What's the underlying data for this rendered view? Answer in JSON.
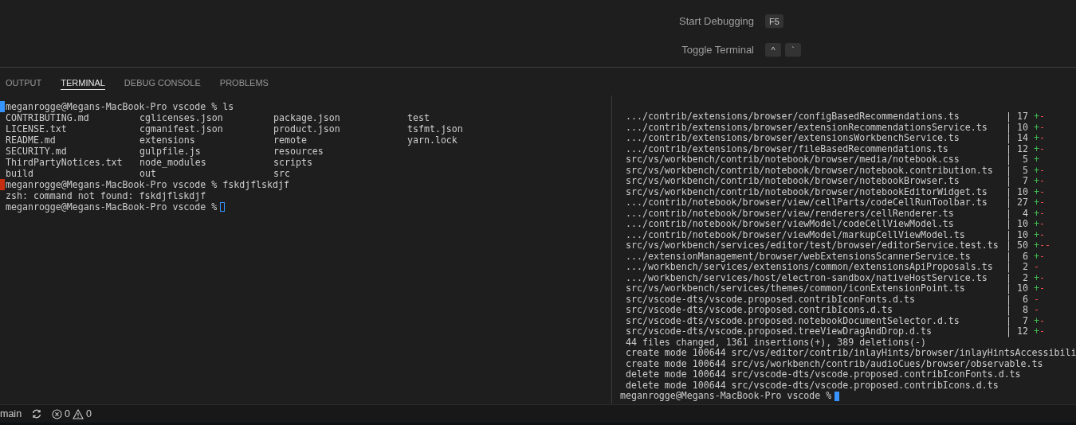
{
  "editor_hints": [
    {
      "label": "Start Debugging",
      "keys": [
        "F5"
      ]
    },
    {
      "label": "Toggle Terminal",
      "keys": [
        "^",
        "`"
      ]
    }
  ],
  "panel": {
    "tabs": [
      {
        "label": "OUTPUT",
        "selected": false
      },
      {
        "label": "TERMINAL",
        "selected": true
      },
      {
        "label": "DEBUG CONSOLE",
        "selected": false
      },
      {
        "label": "PROBLEMS",
        "selected": false
      }
    ]
  },
  "terminal_left": {
    "lines": [
      {
        "kind": "prompt",
        "prompt": "meganrogge@Megans-MacBook-Pro vscode %",
        "command": "ls",
        "succeeded": true
      },
      {
        "kind": "listing",
        "entries": [
          "CONTRIBUTING.md",
          "cglicenses.json",
          "package.json",
          "test"
        ]
      },
      {
        "kind": "listing",
        "entries": [
          "LICENSE.txt",
          "cgmanifest.json",
          "product.json",
          "tsfmt.json"
        ]
      },
      {
        "kind": "listing",
        "entries": [
          "README.md",
          "extensions",
          "remote",
          "yarn.lock"
        ]
      },
      {
        "kind": "listing",
        "entries": [
          "SECURITY.md",
          "gulpfile.js",
          "resources"
        ]
      },
      {
        "kind": "listing",
        "entries": [
          "ThirdPartyNotices.txt",
          "node_modules",
          "scripts"
        ]
      },
      {
        "kind": "listing",
        "entries": [
          "build",
          "out",
          "src"
        ]
      },
      {
        "kind": "prompt",
        "prompt": "meganrogge@Megans-MacBook-Pro vscode %",
        "command": "fskdjflskdjf",
        "succeeded": false
      },
      {
        "kind": "output",
        "text": "zsh: command not found: fskdjflskdjf"
      },
      {
        "kind": "prompt",
        "prompt": "meganrogge@Megans-MacBook-Pro vscode %",
        "cursor_focused": false
      }
    ]
  },
  "terminal_right": {
    "lines": [
      {
        "kind": "stat",
        "path": ".../contrib/extensions/browser/configBasedRecommendations.ts",
        "separator": "|",
        "count": "17",
        "plus": "+",
        "minus": "-"
      },
      {
        "kind": "stat",
        "path": ".../contrib/extensions/browser/extensionRecommendationsService.ts",
        "separator": "|",
        "count": "10",
        "plus": "+",
        "minus": "-"
      },
      {
        "kind": "stat",
        "path": ".../contrib/extensions/browser/extensionsWorkbenchService.ts",
        "separator": "|",
        "count": "14",
        "plus": "+",
        "minus": "-"
      },
      {
        "kind": "stat",
        "path": ".../contrib/extensions/browser/fileBasedRecommendations.ts",
        "separator": "|",
        "count": "12",
        "plus": "+",
        "minus": "-"
      },
      {
        "kind": "stat",
        "path": "src/vs/workbench/contrib/notebook/browser/media/notebook.css",
        "separator": "|",
        "count": "5",
        "plus": "+"
      },
      {
        "kind": "stat",
        "path": "src/vs/workbench/contrib/notebook/browser/notebook.contribution.ts",
        "separator": "|",
        "count": "5",
        "plus": "+",
        "minus": "-"
      },
      {
        "kind": "stat",
        "path": "src/vs/workbench/contrib/notebook/browser/notebookBrowser.ts",
        "separator": "|",
        "count": "7",
        "plus": "+",
        "minus": "-"
      },
      {
        "kind": "stat",
        "path": "src/vs/workbench/contrib/notebook/browser/notebookEditorWidget.ts",
        "separator": "|",
        "count": "10",
        "plus": "+",
        "minus": "-"
      },
      {
        "kind": "stat",
        "path": ".../contrib/notebook/browser/view/cellParts/codeCellRunToolbar.ts",
        "separator": "|",
        "count": "27",
        "plus": "+",
        "minus": "-"
      },
      {
        "kind": "stat",
        "path": ".../contrib/notebook/browser/view/renderers/cellRenderer.ts",
        "separator": "|",
        "count": "4",
        "plus": "+",
        "minus": "-"
      },
      {
        "kind": "stat",
        "path": ".../contrib/notebook/browser/viewModel/codeCellViewModel.ts",
        "separator": "|",
        "count": "10",
        "plus": "+",
        "minus": "-"
      },
      {
        "kind": "stat",
        "path": ".../contrib/notebook/browser/viewModel/markupCellViewModel.ts",
        "separator": "|",
        "count": "10",
        "plus": "+",
        "minus": "-"
      },
      {
        "kind": "stat",
        "path": "src/vs/workbench/services/editor/test/browser/editorService.test.ts",
        "separator": "|",
        "count": "50",
        "plus": "+",
        "minus": "--"
      },
      {
        "kind": "stat",
        "path": ".../extensionManagement/browser/webExtensionsScannerService.ts",
        "separator": "|",
        "count": "6",
        "plus": "+",
        "minus": "-"
      },
      {
        "kind": "stat",
        "path": ".../workbench/services/extensions/common/extensionsApiProposals.ts",
        "separator": "|",
        "count": "2",
        "minus": "-"
      },
      {
        "kind": "stat",
        "path": ".../workbench/services/host/electron-sandbox/nativeHostService.ts",
        "separator": "|",
        "count": "2",
        "plus": "+",
        "minus": "-"
      },
      {
        "kind": "stat",
        "path": "src/vs/workbench/services/themes/common/iconExtensionPoint.ts",
        "separator": "|",
        "count": "10",
        "plus": "+",
        "minus": "-"
      },
      {
        "kind": "stat",
        "path": "src/vscode-dts/vscode.proposed.contribIconFonts.d.ts",
        "separator": "|",
        "count": "6",
        "minus": "-"
      },
      {
        "kind": "stat",
        "path": "src/vscode-dts/vscode.proposed.contribIcons.d.ts",
        "separator": "|",
        "count": "8",
        "minus": "-"
      },
      {
        "kind": "stat",
        "path": "src/vscode-dts/vscode.proposed.notebookDocumentSelector.d.ts",
        "separator": "|",
        "count": "7",
        "plus": "+",
        "minus": "-"
      },
      {
        "kind": "stat",
        "path": "src/vscode-dts/vscode.proposed.treeViewDragAndDrop.d.ts",
        "separator": "|",
        "count": "12",
        "plus": "+",
        "minus": "-"
      },
      {
        "kind": "output",
        "text": "44 files changed, 1361 insertions(+), 389 deletions(-)"
      },
      {
        "kind": "output",
        "text": "create mode 100644 src/vs/editor/contrib/inlayHints/browser/inlayHintsAccessibili"
      },
      {
        "kind": "output",
        "text": "create mode 100644 src/vs/workbench/contrib/audioCues/browser/observable.ts"
      },
      {
        "kind": "output",
        "text": "delete mode 100644 src/vscode-dts/vscode.proposed.contribIconFonts.d.ts"
      },
      {
        "kind": "output",
        "text": "delete mode 100644 src/vscode-dts/vscode.proposed.contribIcons.d.ts"
      },
      {
        "kind": "prompt",
        "prompt": "meganrogge@Megans-MacBook-Pro vscode %",
        "cursor_focused": true
      }
    ]
  },
  "status_bar": {
    "branch": "main",
    "errors": "0",
    "warnings": "0"
  }
}
